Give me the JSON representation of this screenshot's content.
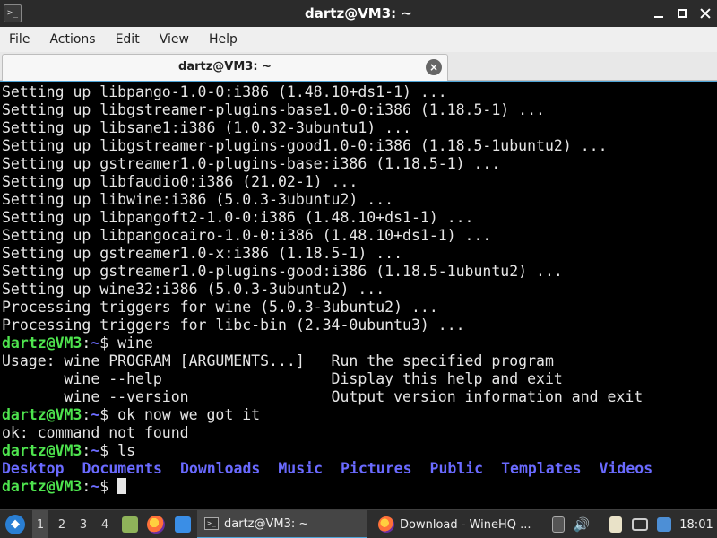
{
  "window": {
    "title": "dartz@VM3: ~"
  },
  "menubar": {
    "items": [
      "File",
      "Actions",
      "Edit",
      "View",
      "Help"
    ]
  },
  "tab": {
    "label": "dartz@VM3: ~"
  },
  "terminal": {
    "output_lines": [
      "Setting up libpango-1.0-0:i386 (1.48.10+ds1-1) ...",
      "Setting up libgstreamer-plugins-base1.0-0:i386 (1.18.5-1) ...",
      "Setting up libsane1:i386 (1.0.32-3ubuntu1) ...",
      "Setting up libgstreamer-plugins-good1.0-0:i386 (1.18.5-1ubuntu2) ...",
      "Setting up gstreamer1.0-plugins-base:i386 (1.18.5-1) ...",
      "Setting up libfaudio0:i386 (21.02-1) ...",
      "Setting up libwine:i386 (5.0.3-3ubuntu2) ...",
      "Setting up libpangoft2-1.0-0:i386 (1.48.10+ds1-1) ...",
      "Setting up libpangocairo-1.0-0:i386 (1.48.10+ds1-1) ...",
      "Setting up gstreamer1.0-x:i386 (1.18.5-1) ...",
      "Setting up gstreamer1.0-plugins-good:i386 (1.18.5-1ubuntu2) ...",
      "Setting up wine32:i386 (5.0.3-3ubuntu2) ...",
      "Processing triggers for wine (5.0.3-3ubuntu2) ...",
      "Processing triggers for libc-bin (2.34-0ubuntu3) ..."
    ],
    "prompt_user": "dartz@VM3",
    "prompt_sep": ":",
    "prompt_path": "~",
    "prompt_symbol": "$ ",
    "command1": "wine",
    "usage_lines": [
      "Usage: wine PROGRAM [ARGUMENTS...]   Run the specified program",
      "       wine --help                   Display this help and exit",
      "       wine --version                Output version information and exit"
    ],
    "command2": "ok now we got it",
    "error_line": "ok: command not found",
    "command3": "ls",
    "ls_output": [
      "Desktop",
      "Documents",
      "Downloads",
      "Music",
      "Pictures",
      "Public",
      "Templates",
      "Videos"
    ],
    "colors": {
      "prompt_user": "#4ee44e",
      "prompt_path": "#6c6cff",
      "directory": "#6a6aff",
      "text": "#e6e6e6",
      "background": "#000000"
    }
  },
  "taskbar": {
    "workspaces": [
      "1",
      "2",
      "3",
      "4"
    ],
    "active_workspace": "1",
    "tasks": [
      {
        "label": "dartz@VM3: ~",
        "icon": "terminal-icon",
        "active": true
      },
      {
        "label": "Download - WineHQ ...",
        "icon": "firefox-icon",
        "active": false
      }
    ],
    "clock": "18:01"
  }
}
